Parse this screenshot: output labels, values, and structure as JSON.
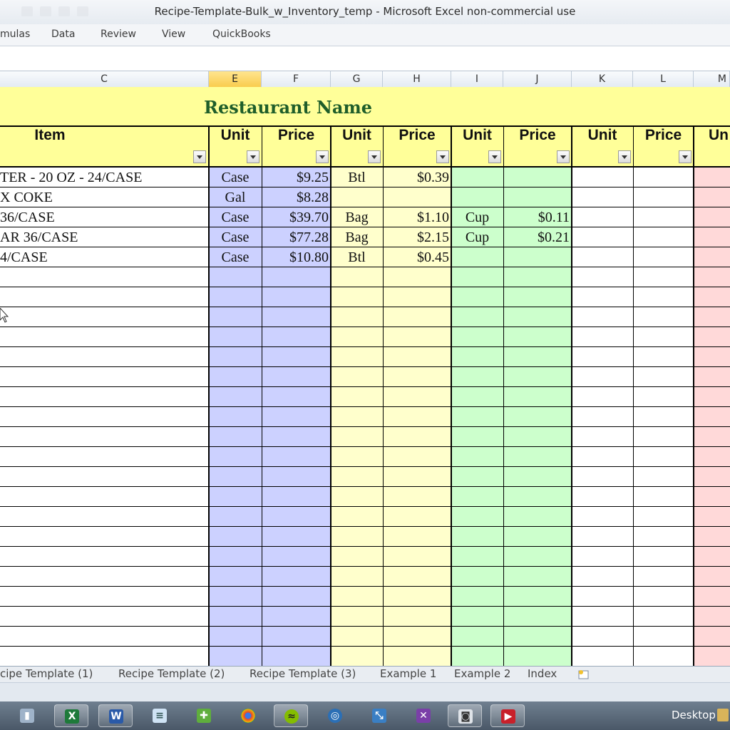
{
  "window": {
    "title": "Recipe-Template-Bulk_w_Inventory_temp  -  Microsoft Excel non-commercial use"
  },
  "ribbon": {
    "tabs": [
      "mulas",
      "Data",
      "Review",
      "View",
      "QuickBooks"
    ]
  },
  "columns": [
    "C",
    "E",
    "F",
    "G",
    "H",
    "I",
    "J",
    "K",
    "L",
    "M"
  ],
  "sheet": {
    "title": "Restaurant Name",
    "headers": {
      "item": "Item",
      "unit": "Unit",
      "price": "Price",
      "partial": "Un"
    },
    "rows": [
      {
        "item": "TER - 20 OZ - 24/CASE",
        "e": "Case",
        "f": "$9.25",
        "g": "Btl",
        "h": "$0.39",
        "i": "",
        "j": ""
      },
      {
        "item": "X COKE",
        "e": "Gal",
        "f": "$8.28",
        "g": "",
        "h": "",
        "i": "",
        "j": ""
      },
      {
        "item": " 36/CASE",
        "e": "Case",
        "f": "$39.70",
        "g": "Bag",
        "h": "$1.10",
        "i": "Cup",
        "j": "$0.11"
      },
      {
        "item": "AR 36/CASE",
        "e": "Case",
        "f": "$77.28",
        "g": "Bag",
        "h": "$2.15",
        "i": "Cup",
        "j": "$0.21"
      },
      {
        "item": "4/CASE",
        "e": "Case",
        "f": "$10.80",
        "g": "Btl",
        "h": "$0.45",
        "i": "",
        "j": ""
      }
    ]
  },
  "sheet_tabs": [
    "cipe Template (1)",
    "Recipe Template (2)",
    "Recipe Template (3)",
    "Example 1",
    "Example 2",
    "Index"
  ],
  "taskbar": {
    "items": [
      "computer-icon",
      "excel-icon",
      "word-icon",
      "notepad-icon",
      "puzzle-icon",
      "chrome-icon",
      "spotify-icon",
      "remote-icon",
      "image-icon",
      "tool-icon",
      "camera-icon",
      "video-icon"
    ],
    "desktop_label": "Desktop"
  },
  "colors": {
    "title_text": "#1f5e2a",
    "header_band": "#ffff99",
    "band_blue": "#ccd1ff",
    "band_yellow": "#ffffcc",
    "band_green": "#ccffcc",
    "band_pink": "#ffd9d9"
  }
}
